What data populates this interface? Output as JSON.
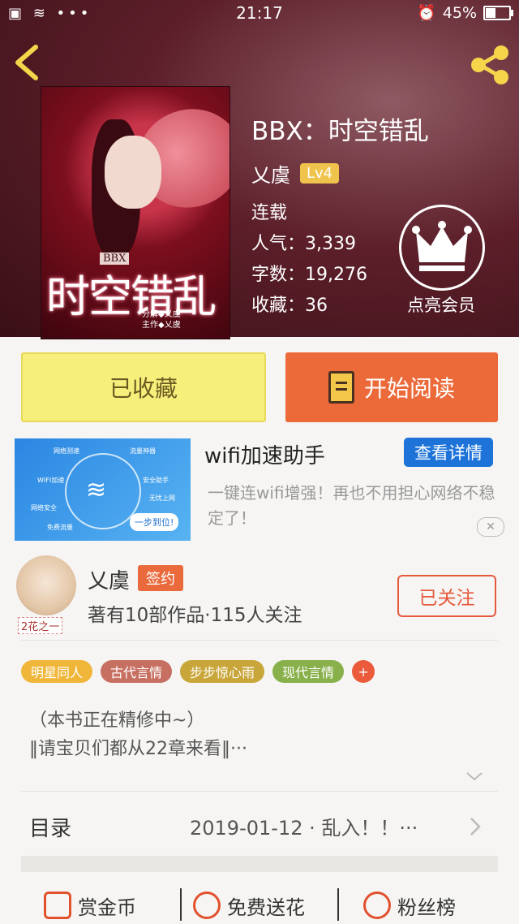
{
  "status_bar": {
    "left_icons": "▣ ≋ •••",
    "time": "21:17",
    "battery_percent": 45,
    "battery_label": "45%"
  },
  "book": {
    "title": "BBX：时空错乱",
    "author": "乂虞",
    "level": "Lv4",
    "status": "连载",
    "popularity": "人气：3,339",
    "word_count": "字数：19,276",
    "favorites": "收藏：36",
    "cover_badge": "BBX",
    "cover_title": "时空错乱",
    "cover_subtitle": "分解◆乂虞\n主作◆乂虞"
  },
  "vip": {
    "label": "点亮会员",
    "icon": "crown-icon"
  },
  "actions": {
    "favorited_label": "已收藏",
    "read_label": "开始阅读"
  },
  "ad": {
    "title": "wifi加速助手",
    "detail_button": "查看详情",
    "description": "一键连wifi增强！再也不用担心网络不稳定了！",
    "image_tags": [
      "网络测速",
      "流量神器",
      "WIFI加速",
      "安全助手",
      "网络安全",
      "无忧上网",
      "免费流量"
    ],
    "image_cta": "一步到位!",
    "close_icon": "close-icon"
  },
  "author_card": {
    "name": "乂虞",
    "signed_badge": "签约",
    "meta": "著有10部作品·115人关注",
    "follow_label": "已关注",
    "avatar_tag": "2花之一"
  },
  "tags": [
    {
      "label": "明星同人",
      "color": "#f0b63a"
    },
    {
      "label": "古代言情",
      "color": "#c77062"
    },
    {
      "label": "步步惊心雨",
      "color": "#c9a63a"
    },
    {
      "label": "现代言情",
      "color": "#88b04b"
    }
  ],
  "tag_more": "+",
  "intro": {
    "line1": "（本书正在精修中~）",
    "line2": "‖请宝贝们都从22章来看‖···"
  },
  "toc": {
    "label": "目录",
    "latest": "2019-01-12 · 乱入！！···"
  },
  "bottom_bar": [
    {
      "label": "赏金币",
      "icon": "coin-icon"
    },
    {
      "label": "免费送花",
      "icon": "flower-icon"
    },
    {
      "label": "粉丝榜",
      "icon": "rank-icon"
    }
  ]
}
